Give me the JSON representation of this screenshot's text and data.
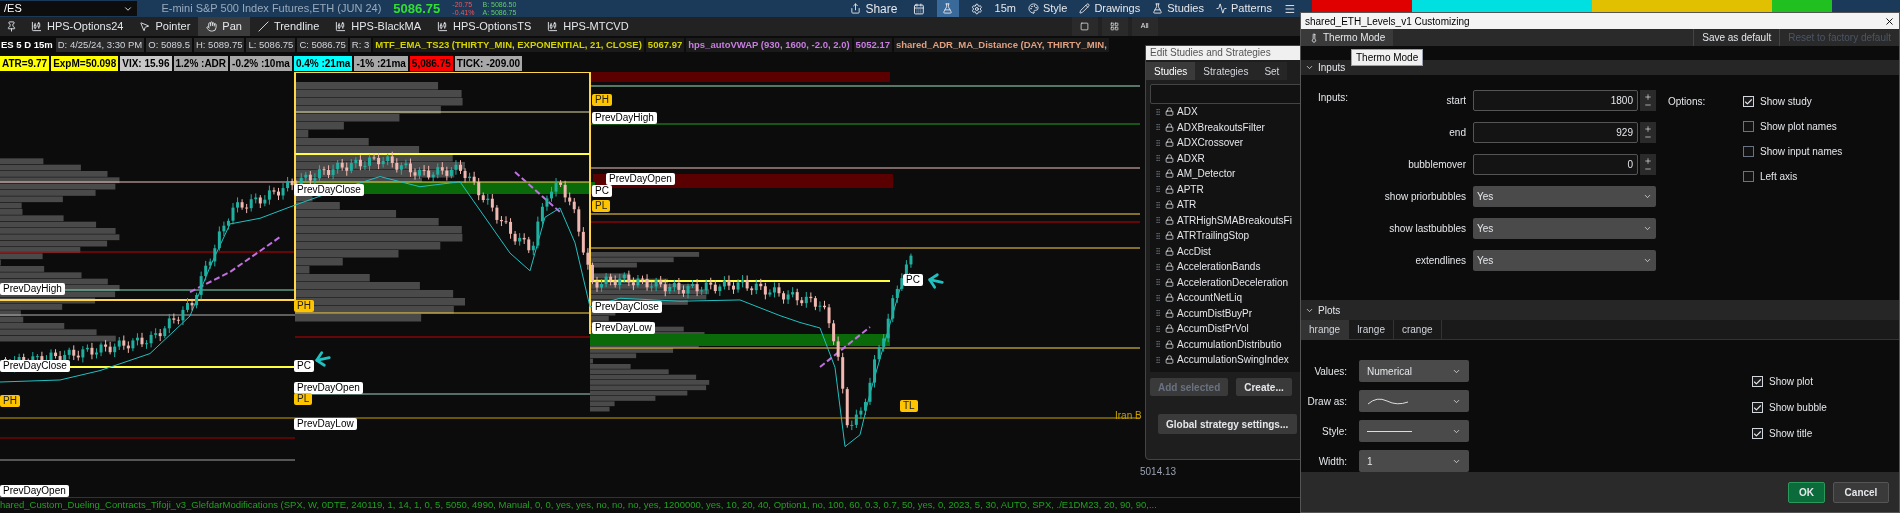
{
  "top_bar": {
    "symbol": "/ES",
    "description": "E-mini S&P 500 Index Futures,ETH (JUN 24)",
    "last": "5086.75",
    "change": "-20.75",
    "change_pct": "-0.41%",
    "bid": "B: 5086.50",
    "ask": "A: 5086.75",
    "share": "Share",
    "menus": [
      {
        "label": "15m",
        "kind": "plain"
      },
      {
        "label": "Style",
        "kind": "style"
      },
      {
        "label": "Drawings",
        "kind": "drawings"
      },
      {
        "label": "Studies",
        "kind": "studies"
      },
      {
        "label": "Patterns",
        "kind": "patterns"
      }
    ]
  },
  "chart_toolbar": [
    {
      "label": "HPS-Options24",
      "kind": "study",
      "selected": false
    },
    {
      "label": "Pointer",
      "kind": "pointer",
      "selected": false
    },
    {
      "label": "Pan",
      "kind": "pan",
      "selected": true
    },
    {
      "label": "Trendline",
      "kind": "trendline",
      "selected": false
    },
    {
      "label": "HPS-BlackMA",
      "kind": "study",
      "selected": false
    },
    {
      "label": "HPS-OptionsTS",
      "kind": "study",
      "selected": false
    },
    {
      "label": "HPS-MTCVD",
      "kind": "study",
      "selected": false
    }
  ],
  "view_buttons": {
    "all": "All"
  },
  "study_header": {
    "bar": "ES 5 D 15m",
    "fields": [
      "D: 4/25/24, 3:30 PM",
      "O: 5089.5",
      "H: 5089.75",
      "L: 5086.75",
      "C: 5086.75",
      "R: 3"
    ],
    "studies": [
      {
        "text": "MTF_EMA_TS23 (THIRTY_MIN, EXPONENTIAL, 21, CLOSE)",
        "color": "#d4d400"
      },
      {
        "text": "5067.97",
        "color": "#d4d400"
      },
      {
        "text": "hps_autoVWAP (930, 1600, -2.0, 2.0)",
        "color": "#c77ee0"
      },
      {
        "text": "5052.17",
        "color": "#c77ee0"
      },
      {
        "text": "shared_ADR_MA_Distance (DAY, THIRTY_MIN,",
        "color": "#e0a080"
      }
    ]
  },
  "indicators": [
    {
      "text": "ATR=9.77",
      "color": "#ffff00"
    },
    {
      "text": "ExpM=50.098",
      "color": "#ffff00"
    },
    {
      "text": "VIX: 15.96",
      "color": "#c8c8c8"
    },
    {
      "text": "1.2% :ADR",
      "color": "#a8a8a8"
    },
    {
      "text": "-0.2% :10ma",
      "color": "#a8a8a8"
    },
    {
      "text": "0.4% :21ma",
      "color": "#00ffff"
    },
    {
      "text": "-1% :21ma",
      "color": "#a8a8a8"
    },
    {
      "text": "5,086.75",
      "color": "#ff0000"
    },
    {
      "text": "TICK: -209.00",
      "color": "#a8a8a8"
    }
  ],
  "chart": {
    "labels": [
      {
        "text": "PrevDayHigh",
        "kind": "note"
      },
      {
        "text": "PrevDayClose",
        "kind": "note"
      },
      {
        "text": "PH",
        "kind": "marker"
      },
      {
        "text": "PrevDayOpen",
        "kind": "note"
      },
      {
        "text": "PrevDayClose",
        "kind": "note"
      },
      {
        "text": "PH",
        "kind": "marker"
      },
      {
        "text": "PC",
        "kind": "note"
      },
      {
        "text": "PrevDayOpen",
        "kind": "note"
      },
      {
        "text": "PL",
        "kind": "marker"
      },
      {
        "text": "PrevDayLow",
        "kind": "note"
      },
      {
        "text": "PH",
        "kind": "marker"
      },
      {
        "text": "PrevDayHigh",
        "kind": "note"
      },
      {
        "text": "PrevDayOpen",
        "kind": "note"
      },
      {
        "text": "PC",
        "kind": "note"
      },
      {
        "text": "PL",
        "kind": "marker"
      },
      {
        "text": "PrevDayClose",
        "kind": "note"
      },
      {
        "text": "PrevDayLow",
        "kind": "note"
      },
      {
        "text": "PC",
        "kind": "note"
      },
      {
        "text": "TL",
        "kind": "marker"
      }
    ],
    "annotation": "Iran B",
    "price_axis": "5014.13"
  },
  "status_line": "hared_Custom_Dueling_Contracts_Tifoji_v3_GlefdarModifications (SPX, W, 0DTE, 240119, 1, 14, 1, 0, 5, 5050, 4990, Manual, 0, 0, yes, yes, no, no, no, yes, 1200000, yes, 10, 20, 40, Option1, no, 100, 60, 0.3, 0.7, 50, yes, 0, 2023, 5, 30, AUTO, SPX, ./E1DM23, 20, 90, 90,...",
  "studies_window": {
    "title": "Edit Studies and Strategies",
    "tabs": [
      {
        "label": "Studies",
        "selected": true
      },
      {
        "label": "Strategies",
        "selected": false
      },
      {
        "label": "Set",
        "selected": false
      }
    ],
    "items": [
      "ADX",
      "ADXBreakoutsFilter",
      "ADXCrossover",
      "ADXR",
      "AM_Detector",
      "APTR",
      "ATR",
      "ATRHighSMABreakoutsFi",
      "ATRTrailingStop",
      "AccDist",
      "AccelerationBands",
      "AccelerationDeceleration",
      "AccountNetLiq",
      "AccumDistBuyPr",
      "AccumDistPrVol",
      "AccumulationDistributio",
      "AccumulationSwingIndex"
    ],
    "buttons": [
      {
        "label": "Add selected",
        "disabled": true
      },
      {
        "label": "Create...",
        "disabled": false
      }
    ],
    "global_button": "Global strategy settings..."
  },
  "customize_dialog": {
    "title": "shared_ETH_Levels_v1 Customizing",
    "thermo_mode": "Thermo Mode",
    "save_default": "Save as default",
    "reset": "Reset to factory default",
    "tooltip": "Thermo Mode",
    "inputs_section": {
      "title": "Inputs",
      "expanded": true
    },
    "inputs_label": "Inputs:",
    "inputs": [
      {
        "label": "start",
        "value": "1800",
        "kind": "number"
      },
      {
        "label": "end",
        "value": "929",
        "kind": "number"
      },
      {
        "label": "bubblemover",
        "value": "0",
        "kind": "number"
      },
      {
        "label": "show priorbubbles",
        "value": "Yes",
        "kind": "choice"
      },
      {
        "label": "show lastbubbles",
        "value": "Yes",
        "kind": "choice"
      },
      {
        "label": "extendlines",
        "value": "Yes",
        "kind": "choice"
      }
    ],
    "options_label": "Options:",
    "options": [
      {
        "label": "Show study",
        "checked": true
      },
      {
        "label": "Show plot names",
        "checked": false
      },
      {
        "label": "Show input names",
        "checked": false
      },
      {
        "label": "Left axis",
        "checked": false
      }
    ],
    "plots_section": {
      "title": "Plots",
      "expanded": true
    },
    "plot_tabs": [
      {
        "label": "hrange",
        "selected": true
      },
      {
        "label": "lrange",
        "selected": false
      },
      {
        "label": "crange",
        "selected": false
      }
    ],
    "plot_settings": [
      {
        "label": "Values:",
        "kind": "text",
        "value": "Numerical"
      },
      {
        "label": "Draw as:",
        "kind": "curve"
      },
      {
        "label": "Style:",
        "kind": "line"
      },
      {
        "label": "Width:",
        "kind": "text",
        "value": "1"
      }
    ],
    "plot_options": [
      {
        "label": "Show plot",
        "checked": true
      },
      {
        "label": "Show bubble",
        "checked": true
      },
      {
        "label": "Show title",
        "checked": true
      }
    ],
    "ok": "OK",
    "cancel": "Cancel"
  }
}
